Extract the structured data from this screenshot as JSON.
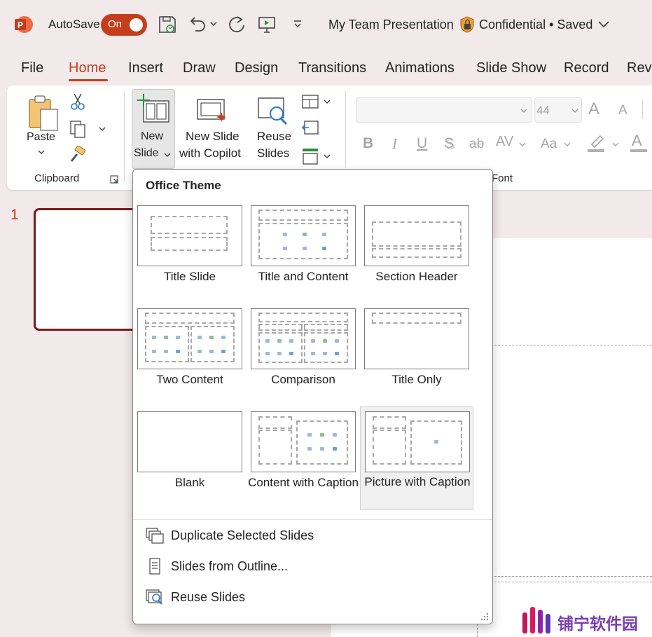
{
  "titlebar": {
    "autosave_label": "AutoSave",
    "toggle_state": "On",
    "document_title": "My Team Presentation",
    "sensitivity": "Confidential • Saved",
    "accent": "#c43e1c"
  },
  "tabs": [
    "File",
    "Home",
    "Insert",
    "Draw",
    "Design",
    "Transitions",
    "Animations",
    "Slide Show",
    "Record",
    "Revi"
  ],
  "active_tab": "Home",
  "ribbon": {
    "paste_label": "Paste",
    "clipboard_group": "Clipboard",
    "new_slide_line1": "New",
    "new_slide_line2": "Slide",
    "copilot_line1": "New Slide",
    "copilot_line2": "with Copilot",
    "reuse_line1": "Reuse",
    "reuse_line2": "Slides",
    "font_size": "44",
    "font_group": "Font",
    "bold": "B",
    "italic": "I",
    "underline": "U",
    "shadow": "S",
    "strike": "ab",
    "spacing": "AV",
    "case": "Aa",
    "grow": "A",
    "shrink": "A",
    "font_color": "A"
  },
  "slides_pane": {
    "number": "1"
  },
  "layout_menu": {
    "title": "Office Theme",
    "layouts": [
      "Title Slide",
      "Title and Content",
      "Section Header",
      "Two Content",
      "Comparison",
      "Title Only",
      "Blank",
      "Content with Caption",
      "Picture with Caption"
    ],
    "selected": "Picture with Caption",
    "commands": {
      "duplicate": "Duplicate Selected Slides",
      "outline": "Slides from Outline...",
      "reuse": "Reuse Slides"
    }
  },
  "watermark": {
    "text": "铺宁软件园"
  }
}
